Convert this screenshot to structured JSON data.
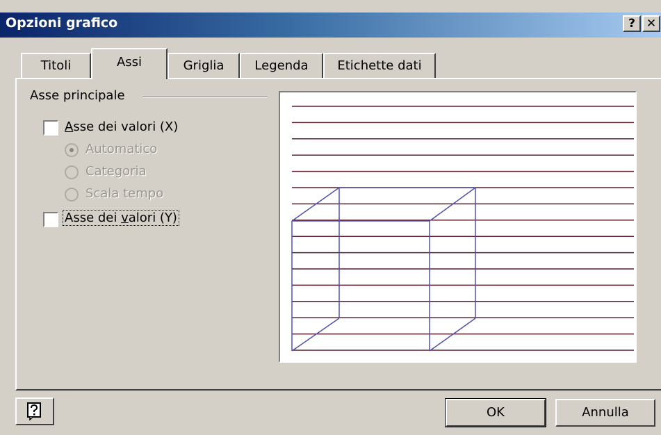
{
  "window": {
    "title": "Opzioni grafico",
    "help_button": "?",
    "close_button": "✕"
  },
  "tabs": [
    {
      "label": "Titoli",
      "active": false
    },
    {
      "label": "Assi",
      "active": true
    },
    {
      "label": "Griglia",
      "active": false
    },
    {
      "label": "Legenda",
      "active": false
    },
    {
      "label": "Etichette dati",
      "active": false
    }
  ],
  "group": {
    "title": "Asse principale"
  },
  "x_axis": {
    "mnemonic": "A",
    "rest": "sse dei valori (X)",
    "checked": false
  },
  "radios": [
    {
      "label": "Automatico",
      "selected": true,
      "enabled": false
    },
    {
      "label": "Categoria",
      "selected": false,
      "enabled": false
    },
    {
      "label": "Scala tempo",
      "selected": false,
      "enabled": false
    }
  ],
  "y_axis": {
    "before": "Asse dei ",
    "mnemonic": "v",
    "after": "alori (Y)",
    "checked": false
  },
  "buttons": {
    "ok": "OK",
    "cancel": "Annulla"
  },
  "colors": {
    "gridline": "#5a1e2a",
    "box": "#5050b0"
  }
}
